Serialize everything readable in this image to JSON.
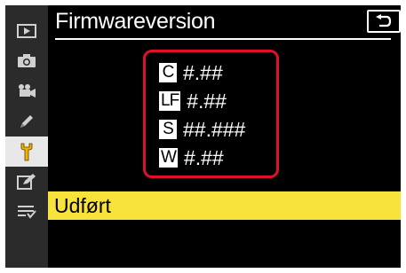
{
  "header": {
    "title": "Firmwareversion",
    "back_icon": "return-arrow-icon"
  },
  "sidebar": {
    "items": [
      {
        "icon": "playback-icon",
        "active": false
      },
      {
        "icon": "camera-icon",
        "active": false
      },
      {
        "icon": "movie-camera-icon",
        "active": false
      },
      {
        "icon": "pencil-icon",
        "active": false
      },
      {
        "icon": "wrench-icon",
        "active": true
      },
      {
        "icon": "retouch-icon",
        "active": false
      },
      {
        "icon": "my-menu-icon",
        "active": false
      }
    ]
  },
  "firmware": {
    "rows": [
      {
        "badge": "C",
        "value": "#.##"
      },
      {
        "badge": "LF",
        "value": "#.##"
      },
      {
        "badge": "S",
        "value": "##.###"
      },
      {
        "badge": "W",
        "value": "#.##"
      }
    ]
  },
  "done": {
    "label": "Udført"
  },
  "colors": {
    "highlight": "#f8e33a",
    "callout_border": "#e1102a",
    "active_tab_icon": "#f0b400"
  }
}
